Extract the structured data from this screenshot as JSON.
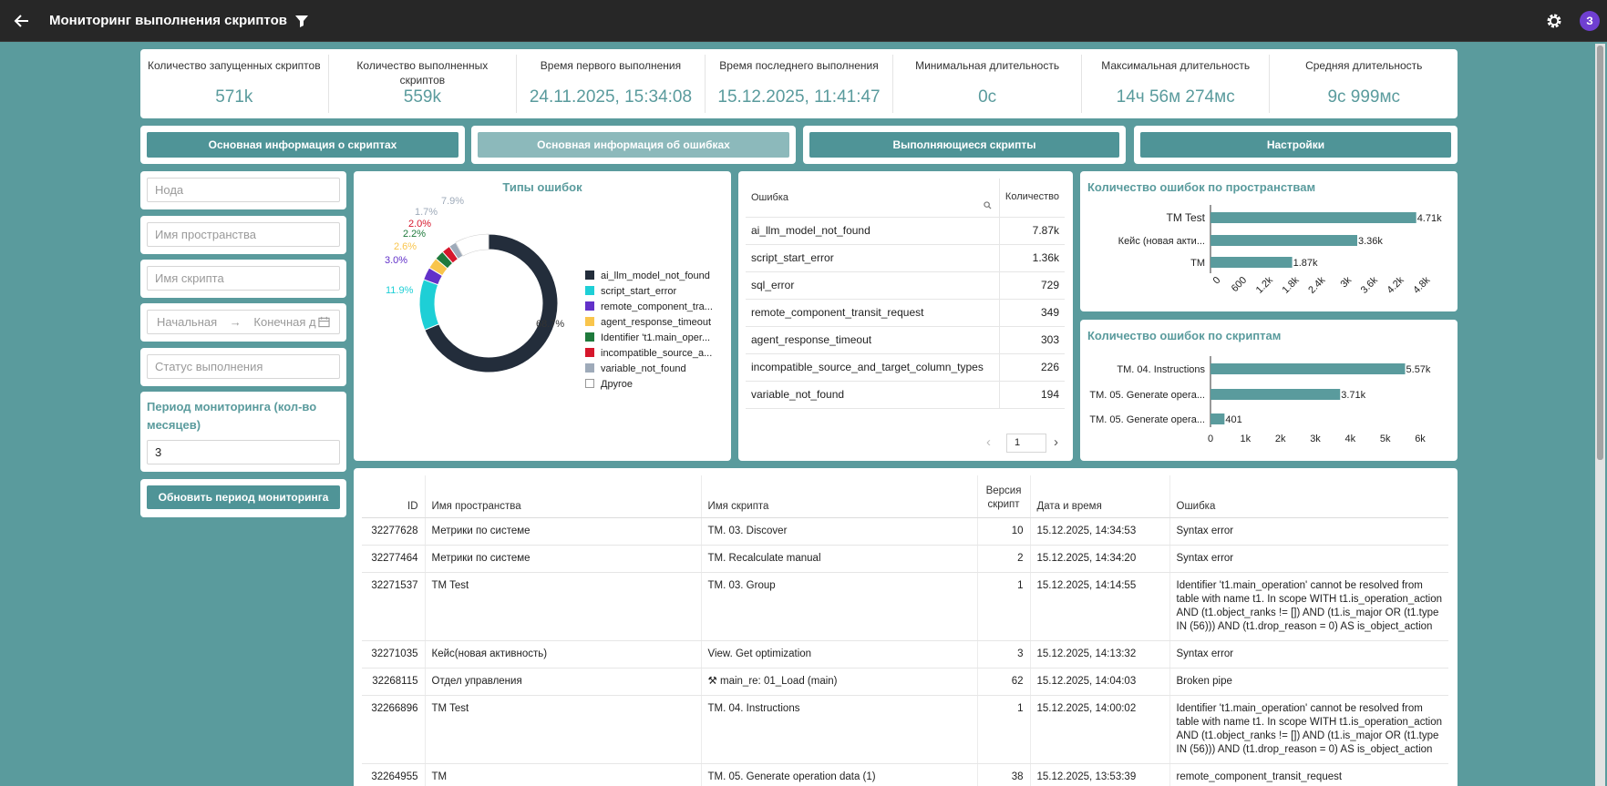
{
  "header": {
    "title": "Мониторинг выполнения скриптов",
    "avatar": "З"
  },
  "stats": [
    {
      "label": "Количество запущенных скриптов",
      "value": "571k"
    },
    {
      "label": "Количество выполненных скриптов",
      "value": "559k"
    },
    {
      "label": "Время первого выполнения",
      "value": "24.11.2025, 15:34:08"
    },
    {
      "label": "Время последнего выполнения",
      "value": "15.12.2025, 11:41:47"
    },
    {
      "label": "Минимальная длительность",
      "value": "0с"
    },
    {
      "label": "Максимальная длительность",
      "value": "14ч 56м 274мс"
    },
    {
      "label": "Средняя длительность",
      "value": "9с 999мс"
    }
  ],
  "tabs": [
    {
      "label": "Основная информация о скриптах",
      "active": false
    },
    {
      "label": "Основная информация об ошибках",
      "active": true
    },
    {
      "label": "Выполняющиеся скрипты",
      "active": false
    },
    {
      "label": "Настройки",
      "active": false
    }
  ],
  "filters": {
    "node_placeholder": "Нода",
    "space_placeholder": "Имя пространства",
    "script_placeholder": "Имя скрипта",
    "date_start": "Начальная",
    "date_end": "Конечная д",
    "status_placeholder": "Статус выполнения",
    "period_title": "Период мониторинга (кол-во месяцев)",
    "period_value": "3",
    "update_button": "Обновить период мониторинга"
  },
  "donut": {
    "title": "Типы ошибок",
    "slices": [
      {
        "name": "ai_llm_model_not_found",
        "legend": "ai_llm_model_not_found",
        "pct": 68.7,
        "label": "68.7%",
        "color": "#232d3b"
      },
      {
        "name": "script_start_error",
        "legend": "script_start_error",
        "pct": 11.9,
        "label": "11.9%",
        "color": "#1ecfd6"
      },
      {
        "name": "remote_component_transit_request",
        "legend": "remote_component_tra...",
        "pct": 3.0,
        "label": "3.0%",
        "color": "#6231c9"
      },
      {
        "name": "agent_response_timeout",
        "legend": "agent_response_timeout",
        "pct": 2.6,
        "label": "2.6%",
        "color": "#f9c54c"
      },
      {
        "name": "Identifier 't1.main_operation'",
        "legend": "Identifier 't1.main_oper...",
        "pct": 2.2,
        "label": "2.2%",
        "color": "#1f7a3c"
      },
      {
        "name": "incompatible_source_and_target_column_types",
        "legend": "incompatible_source_a...",
        "pct": 2.0,
        "label": "2.0%",
        "color": "#d6172c"
      },
      {
        "name": "variable_not_found",
        "legend": "variable_not_found",
        "pct": 1.7,
        "label": "1.7%",
        "color": "#9eaab9"
      },
      {
        "name": "Другое",
        "legend": "Другое",
        "pct": 7.9,
        "label": "7.9%",
        "color": "#ffffff"
      }
    ]
  },
  "errors_table": {
    "col_error": "Ошибка",
    "col_count": "Количество",
    "rows": [
      {
        "error": "ai_llm_model_not_found",
        "count": "7.87k"
      },
      {
        "error": "script_start_error",
        "count": "1.36k"
      },
      {
        "error": "sql_error",
        "count": "729"
      },
      {
        "error": "remote_component_transit_request",
        "count": "349"
      },
      {
        "error": "agent_response_timeout",
        "count": "303"
      },
      {
        "error": "incompatible_source_and_target_column_types",
        "count": "226"
      },
      {
        "error": "variable_not_found",
        "count": "194"
      }
    ],
    "page": "1"
  },
  "chart_data": [
    {
      "type": "bar",
      "orientation": "horizontal",
      "title": "Количество ошибок по пространствам",
      "categories": [
        "TM Test",
        "Кейс (новая акти...",
        "ТМ"
      ],
      "values": [
        4710,
        3360,
        1870
      ],
      "value_labels": [
        "4.71k",
        "3.36k",
        "1.87k"
      ],
      "xticks": [
        "0",
        "600",
        "1.2k",
        "1.8k",
        "2.4k",
        "3k",
        "3.6k",
        "4.2k",
        "4.8k"
      ],
      "xlim": [
        0,
        4800
      ],
      "color": "#5a9b9d"
    },
    {
      "type": "bar",
      "orientation": "horizontal",
      "title": "Количество ошибок по скриптам",
      "categories": [
        "TM. 04. Instructions",
        "TM. 05. Generate opera...",
        "TM. 05. Generate opera..."
      ],
      "values": [
        5570,
        3710,
        401
      ],
      "value_labels": [
        "5.57k",
        "3.71k",
        "401"
      ],
      "xticks": [
        "0",
        "1k",
        "2k",
        "3k",
        "4k",
        "5k",
        "6k"
      ],
      "xlim": [
        0,
        6000
      ],
      "color": "#5a9b9d"
    }
  ],
  "main_table": {
    "headers": [
      "ID",
      "Имя пространства",
      "Имя скрипта",
      "Версия скрипт",
      "Дата и время",
      "Ошибка"
    ],
    "rows": [
      {
        "id": "32277628",
        "space": "Метрики по системе",
        "script": "TM. 03. Discover",
        "ver": "10",
        "dt": "15.12.2025, 14:34:53",
        "err": "Syntax error"
      },
      {
        "id": "32277464",
        "space": "Метрики по системе",
        "script": "TM. Recalculate manual",
        "ver": "2",
        "dt": "15.12.2025, 14:34:20",
        "err": "Syntax error"
      },
      {
        "id": "32271537",
        "space": "TM Test",
        "script": "TM. 03. Group",
        "ver": "1",
        "dt": "15.12.2025, 14:14:55",
        "err": "Identifier 't1.main_operation' cannot be resolved from table with name t1. In scope WITH t1.is_operation_action AND (t1.object_ranks != []) AND (t1.is_major OR (t1.type IN (56))) AND (t1.drop_reason = 0) AS is_object_action"
      },
      {
        "id": "32271035",
        "space": "Кейс(новая активность)",
        "script": "View. Get optimization",
        "ver": "3",
        "dt": "15.12.2025, 14:13:32",
        "err": "Syntax error"
      },
      {
        "id": "32268115",
        "space": "Отдел управления",
        "script": "⚒ main_re: 01_Load (main)",
        "ver": "62",
        "dt": "15.12.2025, 14:04:03",
        "err": "Broken pipe"
      },
      {
        "id": "32266896",
        "space": "TM Test",
        "script": "TM. 04. Instructions",
        "ver": "1",
        "dt": "15.12.2025, 14:00:02",
        "err": "Identifier 't1.main_operation' cannot be resolved from table with name t1. In scope WITH t1.is_operation_action AND (t1.object_ranks != []) AND (t1.is_major OR (t1.type IN (56))) AND (t1.drop_reason = 0) AS is_object_action"
      },
      {
        "id": "32264955",
        "space": "ТМ",
        "script": "TM. 05. Generate operation data (1)",
        "ver": "38",
        "dt": "15.12.2025, 13:53:39",
        "err": "remote_component_transit_request"
      }
    ]
  }
}
